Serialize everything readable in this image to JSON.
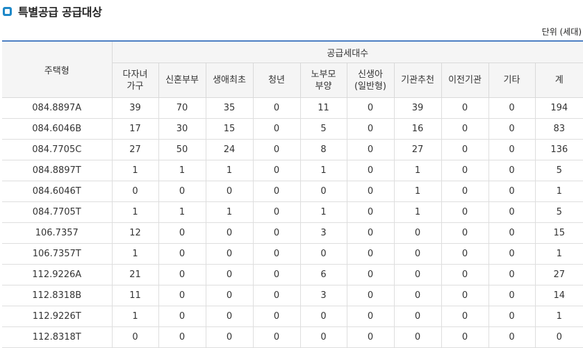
{
  "title": "특별공급 공급대상",
  "unit": "단위 (세대)",
  "header": {
    "type_col": "주택형",
    "group": "공급세대수",
    "columns": [
      {
        "line1": "다자녀",
        "line2": "가구"
      },
      {
        "line1": "신혼부부",
        "line2": ""
      },
      {
        "line1": "생애최초",
        "line2": ""
      },
      {
        "line1": "청년",
        "line2": ""
      },
      {
        "line1": "노부모",
        "line2": "부양"
      },
      {
        "line1": "신생아",
        "line2": "(일반형)"
      },
      {
        "line1": "기관추천",
        "line2": ""
      },
      {
        "line1": "이전기관",
        "line2": ""
      },
      {
        "line1": "기타",
        "line2": ""
      },
      {
        "line1": "계",
        "line2": ""
      }
    ]
  },
  "rows": [
    {
      "type": "084.8897A",
      "values": [
        "39",
        "70",
        "35",
        "0",
        "11",
        "0",
        "39",
        "0",
        "0",
        "194"
      ]
    },
    {
      "type": "084.6046B",
      "values": [
        "17",
        "30",
        "15",
        "0",
        "5",
        "0",
        "16",
        "0",
        "0",
        "83"
      ]
    },
    {
      "type": "084.7705C",
      "values": [
        "27",
        "50",
        "24",
        "0",
        "8",
        "0",
        "27",
        "0",
        "0",
        "136"
      ]
    },
    {
      "type": "084.8897T",
      "values": [
        "1",
        "1",
        "1",
        "0",
        "1",
        "0",
        "1",
        "0",
        "0",
        "5"
      ]
    },
    {
      "type": "084.6046T",
      "values": [
        "0",
        "0",
        "0",
        "0",
        "0",
        "0",
        "1",
        "0",
        "0",
        "1"
      ]
    },
    {
      "type": "084.7705T",
      "values": [
        "1",
        "1",
        "1",
        "0",
        "1",
        "0",
        "1",
        "0",
        "0",
        "5"
      ]
    },
    {
      "type": "106.7357",
      "values": [
        "12",
        "0",
        "0",
        "0",
        "3",
        "0",
        "0",
        "0",
        "0",
        "15"
      ]
    },
    {
      "type": "106.7357T",
      "values": [
        "1",
        "0",
        "0",
        "0",
        "0",
        "0",
        "0",
        "0",
        "0",
        "1"
      ]
    },
    {
      "type": "112.9226A",
      "values": [
        "21",
        "0",
        "0",
        "0",
        "6",
        "0",
        "0",
        "0",
        "0",
        "27"
      ]
    },
    {
      "type": "112.8318B",
      "values": [
        "11",
        "0",
        "0",
        "0",
        "3",
        "0",
        "0",
        "0",
        "0",
        "14"
      ]
    },
    {
      "type": "112.9226T",
      "values": [
        "1",
        "0",
        "0",
        "0",
        "0",
        "0",
        "0",
        "0",
        "0",
        "1"
      ]
    },
    {
      "type": "112.8318T",
      "values": [
        "0",
        "0",
        "0",
        "0",
        "0",
        "0",
        "0",
        "0",
        "0",
        "0"
      ]
    }
  ]
}
